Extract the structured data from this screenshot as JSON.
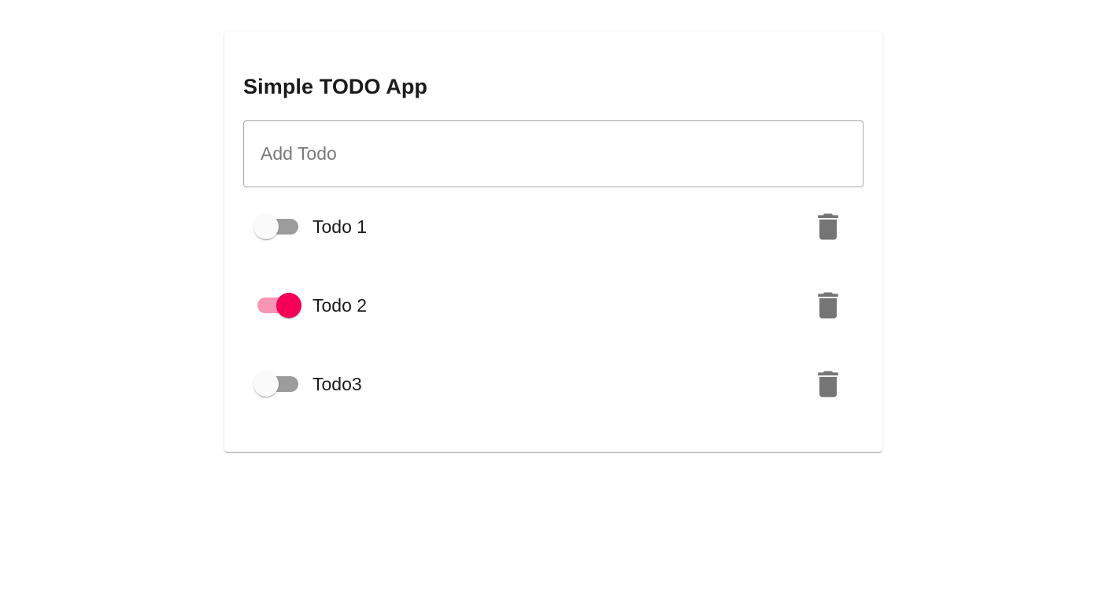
{
  "app": {
    "title": "Simple TODO App"
  },
  "add_todo": {
    "placeholder": "Add Todo",
    "value": ""
  },
  "todos": [
    {
      "label": "Todo 1",
      "completed": false
    },
    {
      "label": "Todo 2",
      "completed": true
    },
    {
      "label": "Todo3",
      "completed": false
    }
  ],
  "icons": {
    "delete": "delete-icon"
  },
  "colors": {
    "accent": "#f50057",
    "accent_track": "#f796b3",
    "switch_off_track": "#9c9c9c",
    "switch_off_thumb": "#fafafa",
    "icon": "#757575",
    "text": "#1b1b1b"
  }
}
